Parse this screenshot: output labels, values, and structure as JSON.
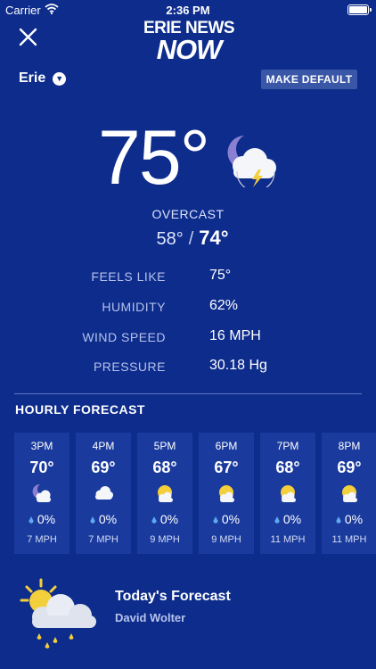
{
  "status_bar": {
    "carrier": "Carrier",
    "time": "2:36 PM"
  },
  "header": {
    "logo_line1": "ERIE NEWS",
    "logo_line2": "NOW"
  },
  "location": {
    "city": "Erie",
    "make_default_label": "MAKE DEFAULT"
  },
  "current": {
    "temperature": "75°",
    "condition": "OVERCAST",
    "low": "58°",
    "separator": "/",
    "high": "74°",
    "icon": "moon-cloud-lightning-icon"
  },
  "details": [
    {
      "label": "FEELS LIKE",
      "value": "75°"
    },
    {
      "label": "HUMIDITY",
      "value": "62%"
    },
    {
      "label": "WIND SPEED",
      "value": "16 MPH"
    },
    {
      "label": "PRESSURE",
      "value": "30.18 Hg"
    }
  ],
  "hourly": {
    "title": "HOURLY FORECAST",
    "items": [
      {
        "time": "3PM",
        "temp": "70°",
        "icon": "moon-cloud-icon",
        "precip": "0%",
        "wind": "7 MPH"
      },
      {
        "time": "4PM",
        "temp": "69°",
        "icon": "cloud-icon",
        "precip": "0%",
        "wind": "7 MPH"
      },
      {
        "time": "5PM",
        "temp": "68°",
        "icon": "sun-cloud-icon",
        "precip": "0%",
        "wind": "9 MPH"
      },
      {
        "time": "6PM",
        "temp": "67°",
        "icon": "sun-cloud-icon",
        "precip": "0%",
        "wind": "9 MPH"
      },
      {
        "time": "7PM",
        "temp": "68°",
        "icon": "sun-cloud-icon",
        "precip": "0%",
        "wind": "11 MPH"
      },
      {
        "time": "8PM",
        "temp": "69°",
        "icon": "sun-cloud-icon",
        "precip": "0%",
        "wind": "11 MPH"
      }
    ]
  },
  "forecast": {
    "title": "Today's Forecast",
    "author": "David Wolter",
    "icon": "sun-cloud-rain-icon"
  },
  "colors": {
    "background": "#0d2c8c",
    "card": "#1a3b9d",
    "button": "#3a56a6",
    "muted_label": "#b6c2ea",
    "sun": "#f2cf3b",
    "moon": "#8a7fd0",
    "rain_drop": "#5ea9f0"
  }
}
